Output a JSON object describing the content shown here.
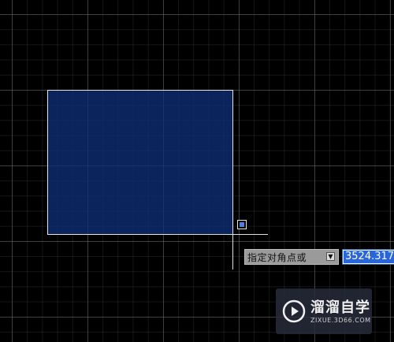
{
  "command_prompt": {
    "text": "指定对角点或",
    "options_icon": "down-arrow-icon"
  },
  "coordinate_input": {
    "value": "3524.3171"
  },
  "watermark": {
    "title": "溜溜自学",
    "url": "ZIXUE.3D66.COM",
    "logo_icon": "play-logo-icon"
  },
  "colors": {
    "background": "#000000",
    "selection_fill": "#102e76",
    "selection_border": "#e6e6e6",
    "input_highlight": "#2a66d9"
  }
}
